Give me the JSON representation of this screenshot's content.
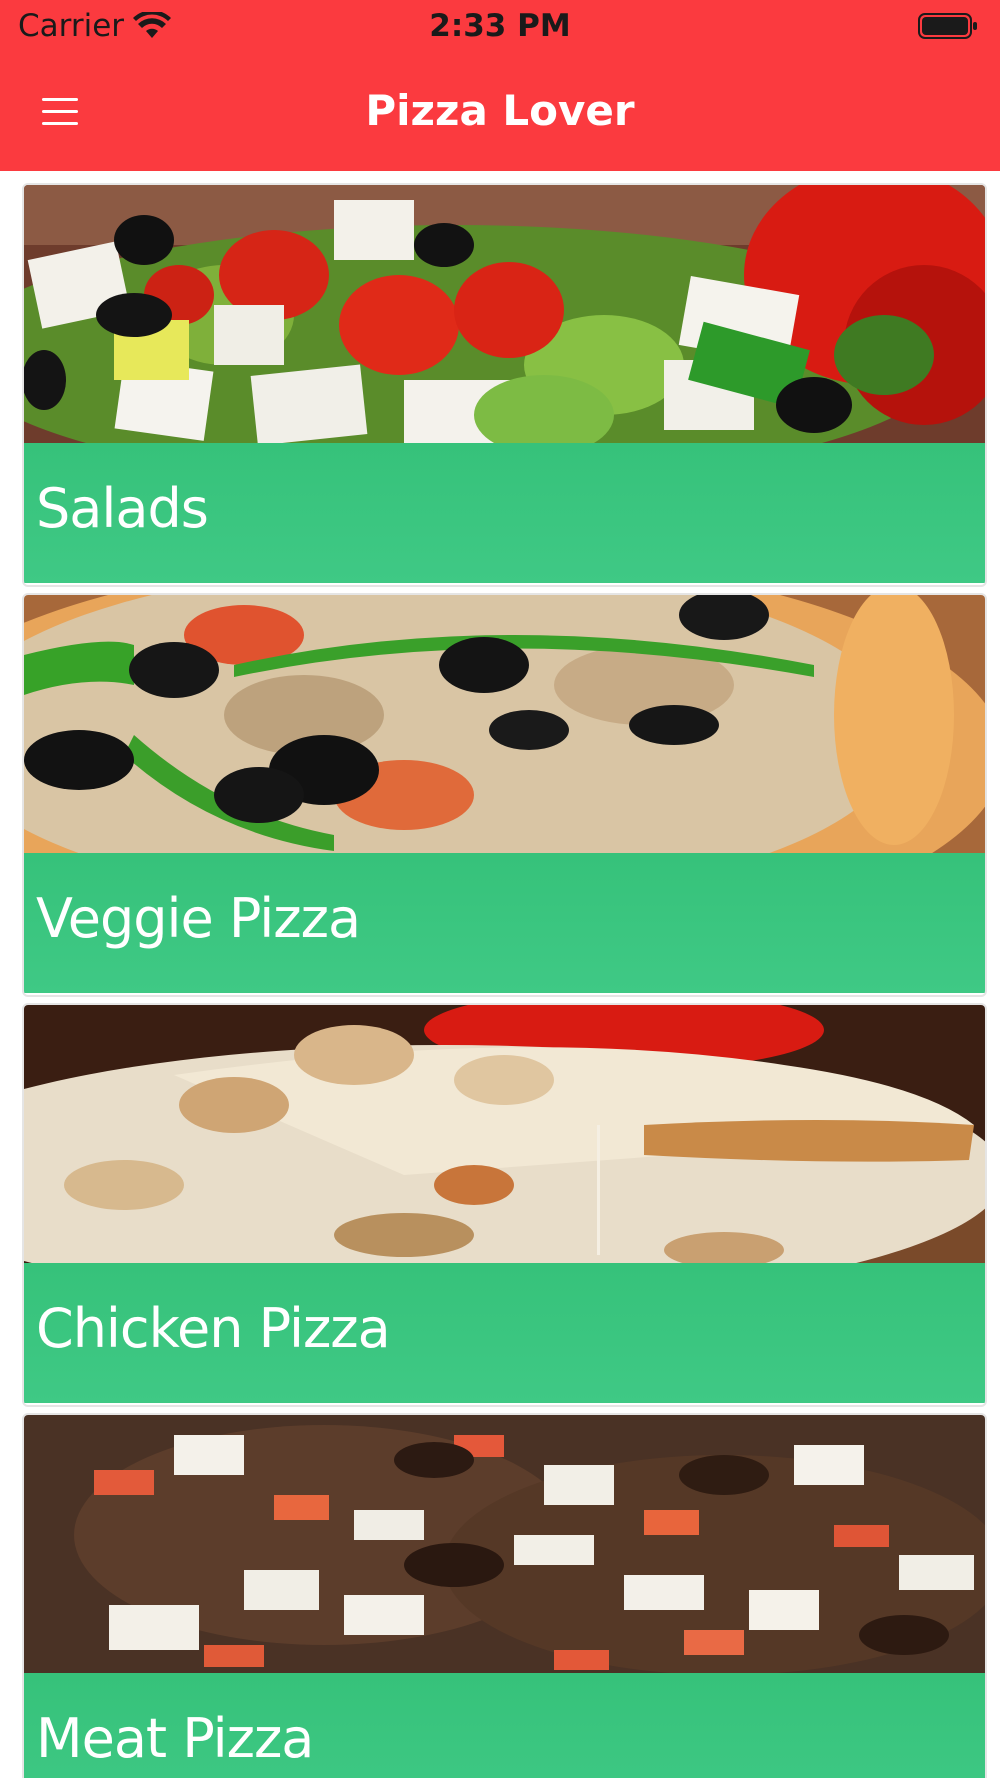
{
  "status_bar": {
    "carrier": "Carrier",
    "time": "2:33 PM"
  },
  "nav": {
    "title": "Pizza Lover",
    "menu_icon": "hamburger-menu-icon"
  },
  "colors": {
    "nav_background": "#fb3a3f",
    "card_band": "#3cc57f",
    "text_on_color": "#ffffff"
  },
  "categories": [
    {
      "label": "Salads",
      "image": "salad-photo"
    },
    {
      "label": "Veggie Pizza",
      "image": "veggie-pizza-photo"
    },
    {
      "label": "Chicken Pizza",
      "image": "chicken-pizza-photo"
    },
    {
      "label": "Meat Pizza",
      "image": "meat-pizza-photo"
    }
  ]
}
